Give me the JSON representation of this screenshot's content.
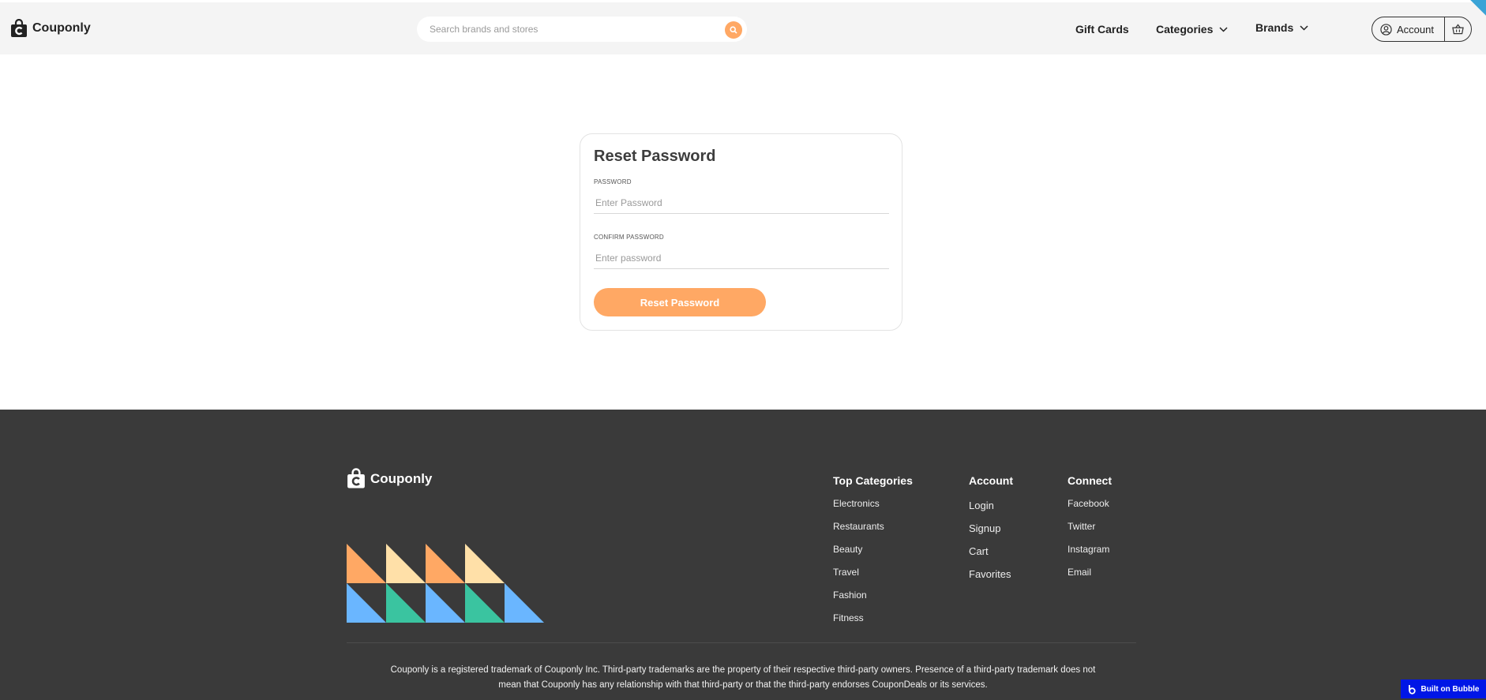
{
  "header": {
    "brand": "Couponly",
    "search_placeholder": "Search brands and stores",
    "nav": {
      "gift_cards": "Gift Cards",
      "categories": "Categories",
      "brands": "Brands"
    },
    "account_label": "Account"
  },
  "form": {
    "title": "Reset Password",
    "password_label": "PASSWORD",
    "password_placeholder": "Enter Password",
    "confirm_label": "CONFIRM PASSWORD",
    "confirm_placeholder": "Enter password",
    "submit_label": "Reset Password"
  },
  "footer": {
    "brand": "Couponly",
    "columns": [
      {
        "heading": "Top Categories",
        "links": [
          "Electronics",
          "Restaurants",
          "Beauty",
          "Travel",
          "Fashion",
          "Fitness"
        ]
      },
      {
        "heading": "Account",
        "links": [
          "Login",
          "Signup",
          "Cart",
          "Favorites"
        ]
      },
      {
        "heading": "Connect",
        "links": [
          "Facebook",
          "Twitter",
          "Instagram",
          "Email"
        ]
      }
    ],
    "legal_line1": "Couponly is a registered trademark of Couponly Inc. Third-party trademarks are the property of their respective third-party owners. Presence of a third-party trademark does not",
    "legal_line2": "mean that Couponly has any relationship with that third-party or that the third-party endorses CouponDeals or its services."
  },
  "badge": {
    "label": "Built on Bubble"
  },
  "colors": {
    "accent": "#ffa864",
    "footer_bg": "#3a3a3a",
    "mosaic": [
      "#ffa864",
      "#ffe0a8",
      "#6ab6ff",
      "#3ac4a0"
    ]
  },
  "icons": [
    "shopping-bag-logo-icon",
    "search-icon",
    "chevron-down-icon",
    "user-circle-icon",
    "basket-icon",
    "bubble-logo-icon"
  ]
}
